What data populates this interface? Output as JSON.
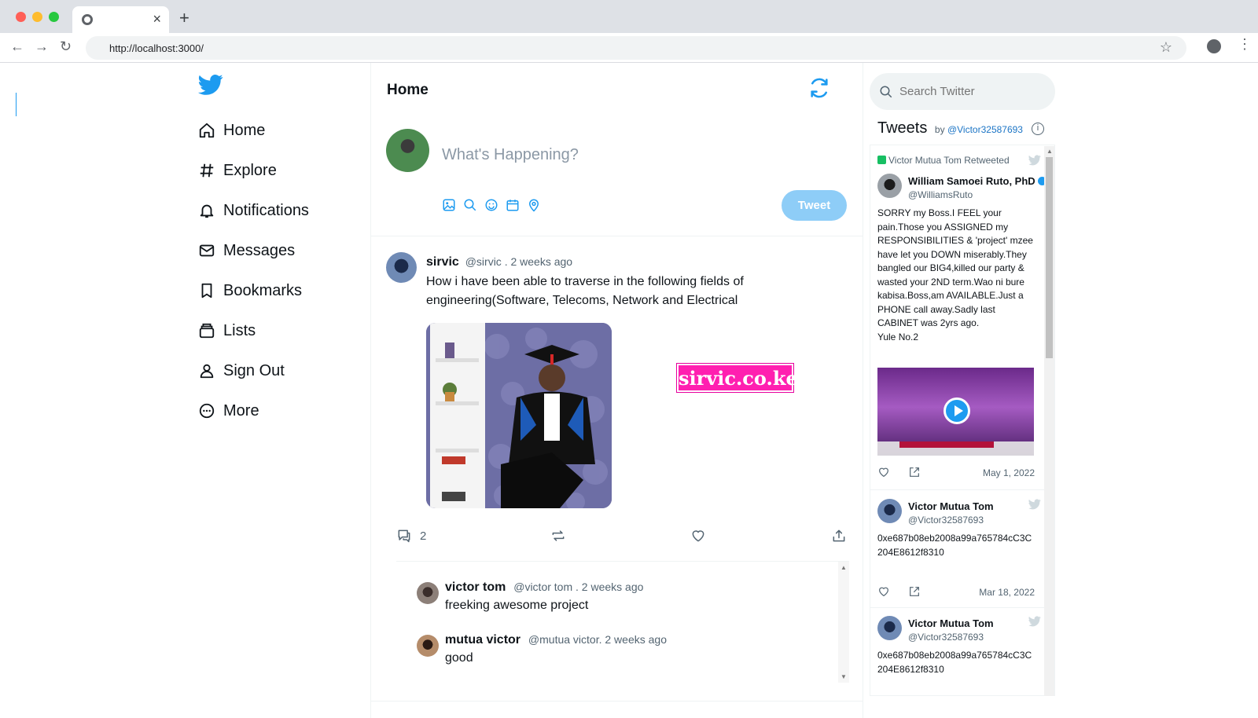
{
  "browser": {
    "url": "http://localhost:3000/"
  },
  "nav": {
    "items": [
      {
        "label": "Home",
        "icon": "home-icon"
      },
      {
        "label": "Explore",
        "icon": "hashtag-icon"
      },
      {
        "label": "Notifications",
        "icon": "bell-icon"
      },
      {
        "label": "Messages",
        "icon": "mail-icon"
      },
      {
        "label": "Bookmarks",
        "icon": "bookmark-icon"
      },
      {
        "label": "Lists",
        "icon": "list-icon"
      },
      {
        "label": "Sign Out",
        "icon": "user-icon"
      },
      {
        "label": "More",
        "icon": "more-icon"
      }
    ]
  },
  "feed": {
    "title": "Home",
    "compose_placeholder": "What's Happening?",
    "tweet_button": "Tweet",
    "post": {
      "name": "sirvic",
      "meta": "@sirvic . 2 weeks ago",
      "text": "How i have been able to traverse in the following fields of engineering(Software, Telecoms, Network and Electrical",
      "tag": "sirvic.co.ke",
      "reply_count": "2"
    },
    "replies": [
      {
        "name": "victor tom",
        "meta": "@victor tom . 2 weeks ago",
        "text": "freeking awesome project"
      },
      {
        "name": "mutua victor",
        "meta": "@mutua victor. 2 weeks ago",
        "text": "good"
      }
    ]
  },
  "sidebar": {
    "search_placeholder": "Search Twitter",
    "timeline_title": "Tweets",
    "timeline_by": "by",
    "timeline_handle": "@Victor32587693",
    "tweets": [
      {
        "retweeted_by": "Victor Mutua Tom Retweeted",
        "name": "William Samoei Ruto, PhD",
        "handle": "@WilliamsRuto",
        "text": "SORRY my Boss.I FEEL your pain.Those you ASSIGNED my RESPONSIBILITIES & 'project' mzee have let you DOWN miserably.They bangled our BIG4,killed our party & wasted your 2ND term.Wao ni bure kabisa.Boss,am AVAILABLE.Just a PHONE call away.Sadly last CABINET was 2yrs ago.",
        "text2": "Yule No.2",
        "date": "May 1, 2022"
      },
      {
        "name": "Victor Mutua Tom",
        "handle": "@Victor32587693",
        "text": "0xe687b08eb2008a99a765784cC3C204E8612f8310",
        "date": "Mar 18, 2022"
      },
      {
        "name": "Victor Mutua Tom",
        "handle": "@Victor32587693",
        "text": "0xe687b08eb2008a99a765784cC3C204E8612f8310"
      }
    ]
  },
  "colors": {
    "accent": "#1d9bf0",
    "tweet_button_disabled": "#8ecdf7",
    "tag": "#ff1fb0"
  }
}
